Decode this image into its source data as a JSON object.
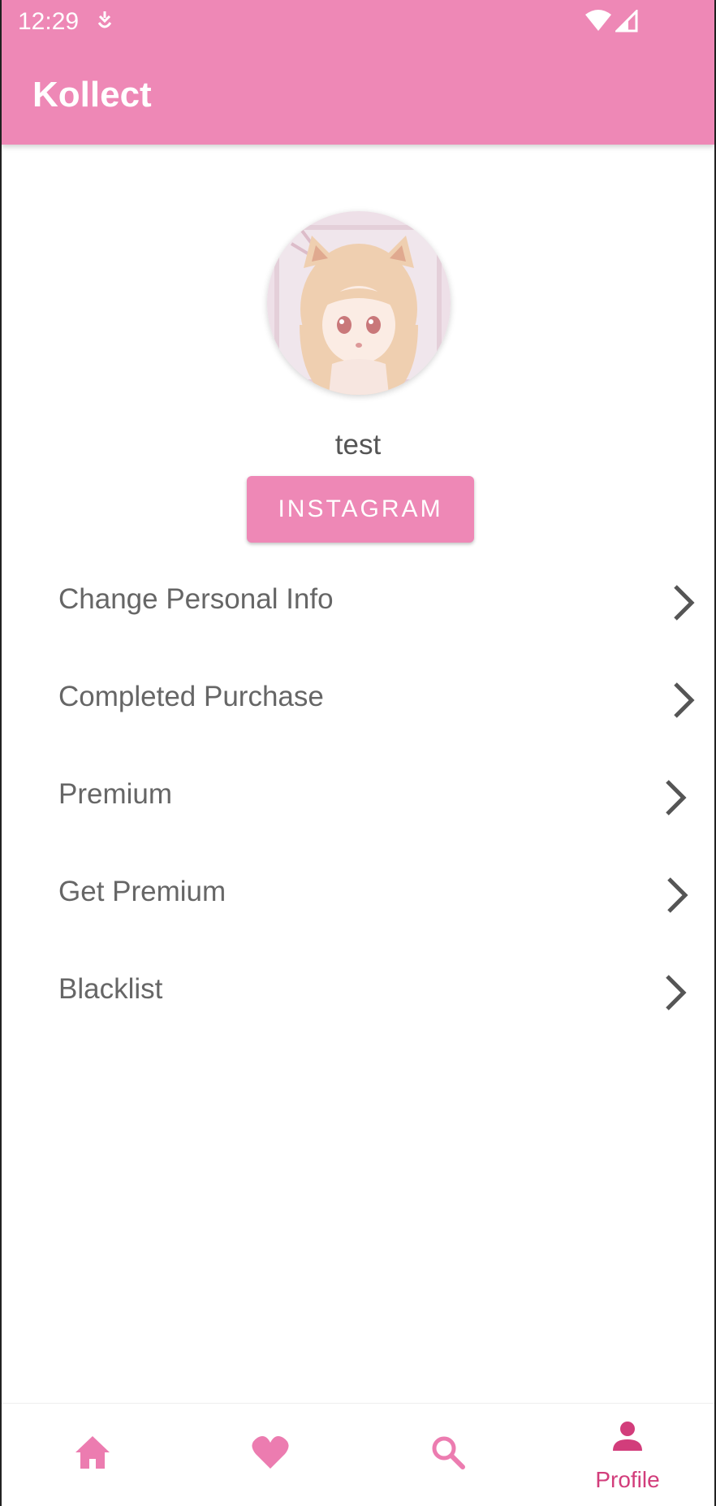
{
  "status_bar": {
    "time": "12:29"
  },
  "app": {
    "title": "Kollect"
  },
  "profile": {
    "username": "test"
  },
  "buttons": {
    "instagram": "INSTAGRAM"
  },
  "menu": [
    {
      "label": "Change Personal Info"
    },
    {
      "label": "Completed Purchase"
    },
    {
      "label": "Premium"
    },
    {
      "label": "Get Premium"
    },
    {
      "label": "Blacklist"
    }
  ],
  "bottom_nav": {
    "items": [
      {
        "icon": "home-icon"
      },
      {
        "icon": "heart-icon"
      },
      {
        "icon": "search-icon"
      },
      {
        "icon": "profile-icon",
        "label": "Profile",
        "selected": true
      }
    ]
  },
  "colors": {
    "primary": "#ee88b6",
    "nav_active": "#d23d7b",
    "nav_icon": "#ec7cb0"
  }
}
